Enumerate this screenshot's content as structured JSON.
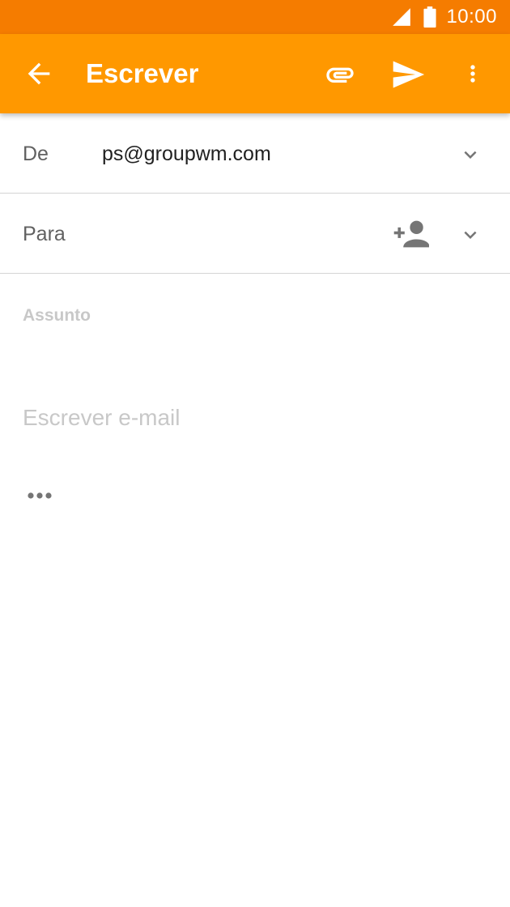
{
  "status_bar": {
    "time": "10:00",
    "icons": [
      "signal-icon",
      "battery-icon"
    ]
  },
  "app_bar": {
    "title": "Escrever",
    "icons": [
      "back-arrow-icon",
      "attachment-icon",
      "send-icon",
      "more-vert-icon"
    ]
  },
  "compose": {
    "from_label": "De",
    "from_value": "ps@groupwm.com",
    "to_label": "Para",
    "subject_placeholder": "Assunto",
    "body_placeholder": "Escrever e-mail"
  },
  "colors": {
    "status_bar": "#f57c00",
    "app_bar": "#ff9800",
    "placeholder": "#c8c8c8",
    "icon_gray": "#757575"
  }
}
